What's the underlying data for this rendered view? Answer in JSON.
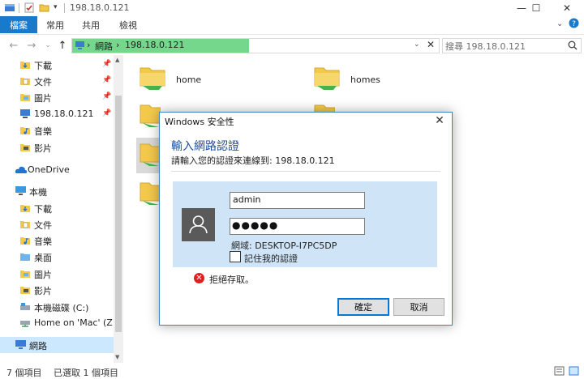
{
  "window": {
    "title": "198.18.0.121",
    "ribbon_tabs": [
      "檔案",
      "常用",
      "共用",
      "檢視"
    ]
  },
  "address": {
    "crumbs": [
      "網路",
      "198.18.0.121"
    ],
    "search_placeholder": "搜尋 198.18.0.121"
  },
  "nav": {
    "quick_access": [
      {
        "label": "下載",
        "icon": "download-folder-icon",
        "pinned": true
      },
      {
        "label": "文件",
        "icon": "documents-folder-icon",
        "pinned": true
      },
      {
        "label": "圖片",
        "icon": "pictures-folder-icon",
        "pinned": true
      },
      {
        "label": "198.18.0.121",
        "icon": "network-computer-icon",
        "pinned": true
      },
      {
        "label": "音樂",
        "icon": "music-folder-icon",
        "pinned": false
      },
      {
        "label": "影片",
        "icon": "video-folder-icon",
        "pinned": false
      }
    ],
    "onedrive": "OneDrive",
    "this_pc": "本機",
    "this_pc_items": [
      {
        "label": "下載",
        "icon": "download-folder-icon"
      },
      {
        "label": "文件",
        "icon": "documents-folder-icon"
      },
      {
        "label": "音樂",
        "icon": "music-folder-icon"
      },
      {
        "label": "桌面",
        "icon": "desktop-folder-icon"
      },
      {
        "label": "圖片",
        "icon": "pictures-folder-icon"
      },
      {
        "label": "影片",
        "icon": "video-folder-icon"
      },
      {
        "label": "本機磁碟 (C:)",
        "icon": "local-disk-icon"
      },
      {
        "label": "Home on 'Mac' (Z:)",
        "icon": "network-drive-icon"
      }
    ],
    "network": "網路"
  },
  "content": {
    "shares": [
      "home",
      "homes"
    ]
  },
  "status": {
    "item_count": "7 個項目",
    "selected": "已選取 1 個項目"
  },
  "dialog": {
    "title": "Windows 安全性",
    "heading": "輸入網路認證",
    "subtitle": "請輸入您的認證來連線到: 198.18.0.121",
    "username": "admin",
    "password": "●●●●●",
    "domain": "網域: DESKTOP-I7PC5DP",
    "remember": "記住我的認證",
    "error": "拒絕存取。",
    "ok": "確定",
    "cancel": "取消"
  },
  "colors": {
    "accent": "#1979ca",
    "address_progress": "#74d78b",
    "credential_panel": "#cfe5f7",
    "error": "#e02020"
  }
}
